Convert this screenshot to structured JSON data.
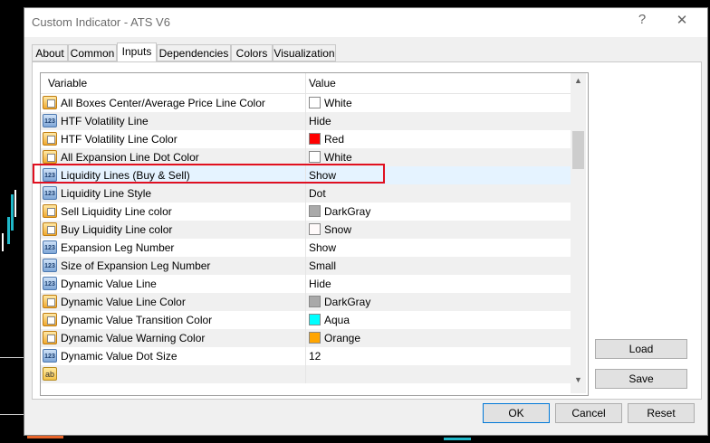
{
  "dialog": {
    "title": "Custom Indicator - ATS V6",
    "help_label": "?",
    "close_label": "✕"
  },
  "tabs": [
    {
      "label": "About"
    },
    {
      "label": "Common"
    },
    {
      "label": "Inputs"
    },
    {
      "label": "Dependencies"
    },
    {
      "label": "Colors"
    },
    {
      "label": "Visualization"
    }
  ],
  "active_tab": "Inputs",
  "grid": {
    "col_variable": "Variable",
    "col_value": "Value",
    "rows": [
      {
        "icon": "color",
        "variable": "All Boxes Center/Average Price Line Color",
        "value": "White",
        "swatch": "#ffffff"
      },
      {
        "icon": "number",
        "variable": "HTF Volatility Line",
        "value": "Hide"
      },
      {
        "icon": "color",
        "variable": "HTF Volatility Line Color",
        "value": "Red",
        "swatch": "#ff0000"
      },
      {
        "icon": "color",
        "variable": "All Expansion Line Dot Color",
        "value": "White",
        "swatch": "#ffffff"
      },
      {
        "icon": "number",
        "variable": "Liquidity Lines (Buy & Sell)",
        "value": "Show"
      },
      {
        "icon": "number",
        "variable": "Liquidity Line Style",
        "value": "Dot"
      },
      {
        "icon": "color",
        "variable": "Sell Liquidity Line color",
        "value": "DarkGray",
        "swatch": "#a9a9a9"
      },
      {
        "icon": "color",
        "variable": "Buy Liquidity Line color",
        "value": "Snow",
        "swatch": "#fffafa"
      },
      {
        "icon": "number",
        "variable": "Expansion Leg Number",
        "value": "Show"
      },
      {
        "icon": "number",
        "variable": "Size of Expansion Leg Number",
        "value": "Small"
      },
      {
        "icon": "number",
        "variable": "Dynamic Value Line",
        "value": "Hide"
      },
      {
        "icon": "color",
        "variable": "Dynamic Value Line Color",
        "value": "DarkGray",
        "swatch": "#a9a9a9"
      },
      {
        "icon": "color",
        "variable": "Dynamic Value Transition Color",
        "value": "Aqua",
        "swatch": "#00ffff"
      },
      {
        "icon": "color",
        "variable": "Dynamic Value Warning Color",
        "value": "Orange",
        "swatch": "#ffa500"
      },
      {
        "icon": "number",
        "variable": "Dynamic Value Dot Size",
        "value": "12"
      },
      {
        "icon": "text",
        "variable": "",
        "value": ""
      }
    ],
    "highlighted_variable": "Liquidity Lines (Buy & Sell)"
  },
  "side_buttons": {
    "load": "Load",
    "save": "Save"
  },
  "footer_buttons": {
    "ok": "OK",
    "cancel": "Cancel",
    "reset": "Reset"
  },
  "icons": {
    "number": "123",
    "text": "ab"
  }
}
